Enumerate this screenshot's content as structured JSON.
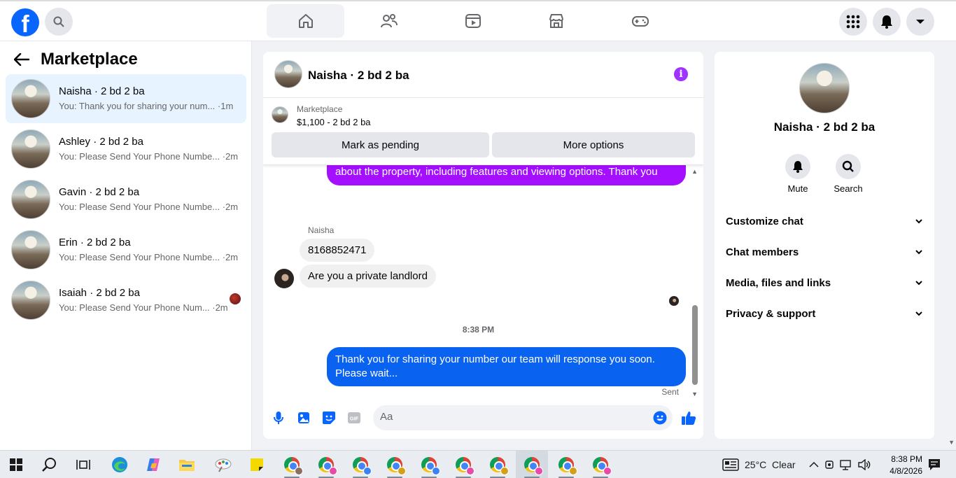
{
  "nav": {
    "tabs": [
      {
        "name": "home",
        "active": true
      },
      {
        "name": "friends",
        "active": false
      },
      {
        "name": "watch",
        "active": false
      },
      {
        "name": "marketplace",
        "active": false
      },
      {
        "name": "gaming",
        "active": false
      }
    ]
  },
  "sidebar": {
    "title": "Marketplace",
    "conversations": [
      {
        "name": "Naisha · 2 bd 2 ba",
        "snippet": "You: Thank you for sharing your num... ·1m",
        "active": true
      },
      {
        "name": "Ashley · 2 bd 2 ba",
        "snippet": "You: Please Send Your Phone Numbe... ·2m",
        "active": false
      },
      {
        "name": "Gavin · 2 bd 2 ba",
        "snippet": "You: Please Send Your Phone Numbe... ·2m",
        "active": false
      },
      {
        "name": "Erin · 2 bd 2 ba",
        "snippet": "You: Please Send Your Phone Numbe... ·2m",
        "active": false
      },
      {
        "name": "Isaiah · 2 bd 2 ba",
        "snippet": "You: Please Send Your Phone Num... ·2m",
        "active": false
      }
    ]
  },
  "chat": {
    "title": "Naisha · 2 bd 2 ba",
    "marketplace_label": "Marketplace",
    "listing": "$1,100 - 2 bd 2 ba",
    "pending_button": "Mark as pending",
    "options_button": "More options",
    "prev_message": "about the property, including features and viewing options.  Thank you",
    "sender_name": "Naisha",
    "in_messages": [
      "8168852471",
      "Are you a private landlord"
    ],
    "time_separator": "8:38 PM",
    "out_message": "Thank you for sharing your number our team will response you soon. Please wait...",
    "status": "Sent",
    "composer_placeholder": "Aa",
    "gif_label": "GIF"
  },
  "details": {
    "name": "Naisha · 2 bd 2 ba",
    "mute_label": "Mute",
    "search_label": "Search",
    "sections": [
      "Customize chat",
      "Chat members",
      "Media, files and links",
      "Privacy & support"
    ]
  },
  "taskbar": {
    "weather": "25°C  Clear",
    "time": "8:38 PM",
    "date": "4/8/2026"
  },
  "colors": {
    "accent": "#0866ff",
    "outgoing_bubble": "#0a62f0",
    "purple_bubble": "#a40fff"
  }
}
